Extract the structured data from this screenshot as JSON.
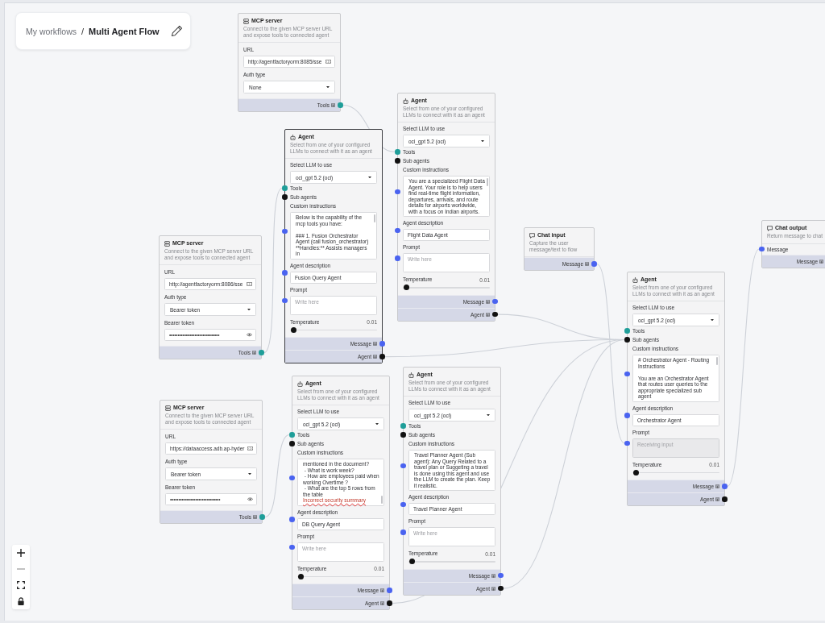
{
  "breadcrumb": {
    "parent": "My workflows",
    "separator": "/",
    "current": "Multi Agent Flow"
  },
  "nodes": [
    {
      "kind": "mcp_server",
      "selected": false,
      "title": "MCP server",
      "description": "Connect to the given MCP server URL and expose tools to connected agent",
      "url": {
        "label": "URL",
        "value": "http://agentfactoryorm:8085/sse"
      },
      "auth": {
        "label": "Auth type",
        "value": "None"
      },
      "outputs": [
        {
          "label": "Tools",
          "color": "#1f9e99"
        }
      ]
    },
    {
      "kind": "agent",
      "selected": true,
      "title": "Agent",
      "description": "Select from one of your configured LLMs to connect with it as an agent",
      "llm": {
        "label": "Select LLM to use",
        "value": "oci_gpt 5.2 (oci)"
      },
      "inputs": [
        {
          "label": "Tools",
          "color": "#1f9e99"
        },
        {
          "label": "Sub agents",
          "color": "#111111"
        }
      ],
      "instructions": {
        "label": "Custom instructions",
        "text": "Below is the capability of the mcp tools you have:\n\n### 1. Fusion Orchestrator Agent (call fusion_orchestrator)\n**Handles:** Assists managers in",
        "scrollbar": true,
        "scrolled": false
      },
      "agent_description": {
        "label": "Agent description",
        "value": "Fusion Query Agent"
      },
      "prompt": {
        "label": "Prompt",
        "placeholder": "Write here",
        "disabled": false
      },
      "temperature": {
        "label": "Temperature",
        "reading": "0.01",
        "level": 0.01
      },
      "outputs": [
        {
          "label": "Message",
          "color": "#4a63f0"
        },
        {
          "label": "Agent",
          "color": "#111111"
        }
      ]
    },
    {
      "kind": "agent",
      "selected": false,
      "title": "Agent",
      "description": "Select from one of your configured LLMs to connect with it as an agent",
      "llm": {
        "label": "Select LLM to use",
        "value": "oci_gpt 5.2 (oci)"
      },
      "inputs": [
        {
          "label": "Tools",
          "color": "#1f9e99"
        },
        {
          "label": "Sub agents",
          "color": "#111111"
        }
      ],
      "instructions": {
        "label": "Custom instructions",
        "text": "You are a specialized Flight Data Agent. Your role is to help users find real-time flight information, departures, arrivals, and route details for airports worldwide, with a focus on Indian airports.",
        "scrollbar": true,
        "scrolled": false
      },
      "agent_description": {
        "label": "Agent description",
        "value": "Flight Data Agent"
      },
      "prompt": {
        "label": "Prompt",
        "placeholder": "Write here",
        "disabled": false
      },
      "temperature": {
        "label": "Temperature",
        "reading": "0.01",
        "level": 0.01
      },
      "outputs": [
        {
          "label": "Message",
          "color": "#4a63f0"
        },
        {
          "label": "Agent",
          "color": "#111111"
        }
      ]
    },
    {
      "kind": "mcp_server",
      "selected": false,
      "title": "MCP server",
      "description": "Connect to the given MCP server URL and expose tools to connected agent",
      "url": {
        "label": "URL",
        "value": "http://agentfactoryorm:8086/sse"
      },
      "auth": {
        "label": "Auth type",
        "value": "Bearer token"
      },
      "token": {
        "label": "Bearer token",
        "value": "••••••••••••••••••••••••••••••"
      },
      "outputs": [
        {
          "label": "Tools",
          "color": "#1f9e99"
        }
      ]
    },
    {
      "kind": "chat_input",
      "selected": false,
      "title": "Chat input",
      "description": "Capture the user message/text to flow",
      "outputs": [
        {
          "label": "Message",
          "color": "#4a63f0"
        }
      ]
    },
    {
      "kind": "chat_output",
      "selected": false,
      "title": "Chat output",
      "description": "Return message to chat",
      "inputs": [
        {
          "label": "Message",
          "color": "#4a63f0"
        }
      ],
      "outputs": [
        {
          "label": "Message"
        }
      ]
    },
    {
      "kind": "agent",
      "selected": false,
      "title": "Agent",
      "description": "Select from one of your configured LLMs to connect with it as an agent",
      "llm": {
        "label": "Select LLM to use",
        "value": "oci_gpt 5.2 (oci)"
      },
      "inputs": [
        {
          "label": "Tools",
          "color": "#1f9e99"
        },
        {
          "label": "Sub agents",
          "color": "#111111"
        }
      ],
      "instructions": {
        "label": "Custom instructions",
        "text": "# Orchestrator Agent - Routing Instructions\n\nYou are an Orchestrator Agent that routes user queries to the appropriate specialized sub agent",
        "scrollbar": true,
        "scrolled": false
      },
      "agent_description": {
        "label": "Agent description",
        "value": "Orchestrator Agent"
      },
      "prompt": {
        "label": "Prompt",
        "placeholder": "Receiving input",
        "disabled": true
      },
      "temperature": {
        "label": "Temperature",
        "reading": "0.01",
        "level": 0.01
      },
      "outputs": [
        {
          "label": "Message",
          "color": "#4a63f0"
        },
        {
          "label": "Agent",
          "color": "#111111"
        }
      ]
    },
    {
      "kind": "mcp_server",
      "selected": false,
      "title": "MCP server",
      "description": "Connect to the given MCP server URL and expose tools to connected agent",
      "url": {
        "label": "URL",
        "value": "https://dataaccess.adb.ap-hyder"
      },
      "auth": {
        "label": "Auth type",
        "value": "Bearer token"
      },
      "token": {
        "label": "Bearer token",
        "value": "••••••••••••••••••••••••••••••"
      },
      "outputs": [
        {
          "label": "Tools",
          "color": "#1f9e99"
        }
      ]
    },
    {
      "kind": "agent",
      "selected": false,
      "title": "Agent",
      "description": "Select from one of your configured LLMs to connect with it as an agent",
      "llm": {
        "label": "Select LLM to use",
        "value": "oci_gpt 5.2 (oci)"
      },
      "inputs": [
        {
          "label": "Tools",
          "color": "#1f9e99"
        },
        {
          "label": "Sub agents",
          "color": "#111111"
        }
      ],
      "instructions": {
        "label": "Custom instructions",
        "text": "mentioned in the document?\n - What is work week?\n - How are employees paid when working Overtime ?\n - What are the top 5 rows from the table",
        "flagged_text": "Incorrect security summary",
        "scrollbar": true,
        "scrolled": true
      },
      "agent_description": {
        "label": "Agent description",
        "value": "DB Query Agent"
      },
      "prompt": {
        "label": "Prompt",
        "placeholder": "Write here",
        "disabled": false
      },
      "temperature": {
        "label": "Temperature",
        "reading": "0.01",
        "level": 0.01
      },
      "outputs": [
        {
          "label": "Message",
          "color": "#4a63f0"
        },
        {
          "label": "Agent",
          "color": "#111111"
        }
      ]
    },
    {
      "kind": "agent",
      "selected": false,
      "title": "Agent",
      "description": "Select from one of your configured LLMs to connect with it as an agent",
      "llm": {
        "label": "Select LLM to use",
        "value": "oci_gpt 5.2 (oci)"
      },
      "inputs": [
        {
          "label": "Tools",
          "color": "#1f9e99"
        },
        {
          "label": "Sub agents",
          "color": "#111111"
        }
      ],
      "instructions": {
        "label": "Custom instructions",
        "text": "Travel Planner Agent (Sub agent): Any Query Related to a travel plan or Suggeting a travel is done using this agent and use the LLM to create the plan. Keep it realistic."
      },
      "agent_description": {
        "label": "Agent description",
        "value": "Travel Planner Agent"
      },
      "prompt": {
        "label": "Prompt",
        "placeholder": "Write here",
        "disabled": false
      },
      "temperature": {
        "label": "Temperature",
        "reading": "0.01",
        "level": 0.01
      },
      "outputs": [
        {
          "label": "Message",
          "color": "#4a63f0"
        },
        {
          "label": "Agent",
          "color": "#111111"
        }
      ]
    }
  ]
}
